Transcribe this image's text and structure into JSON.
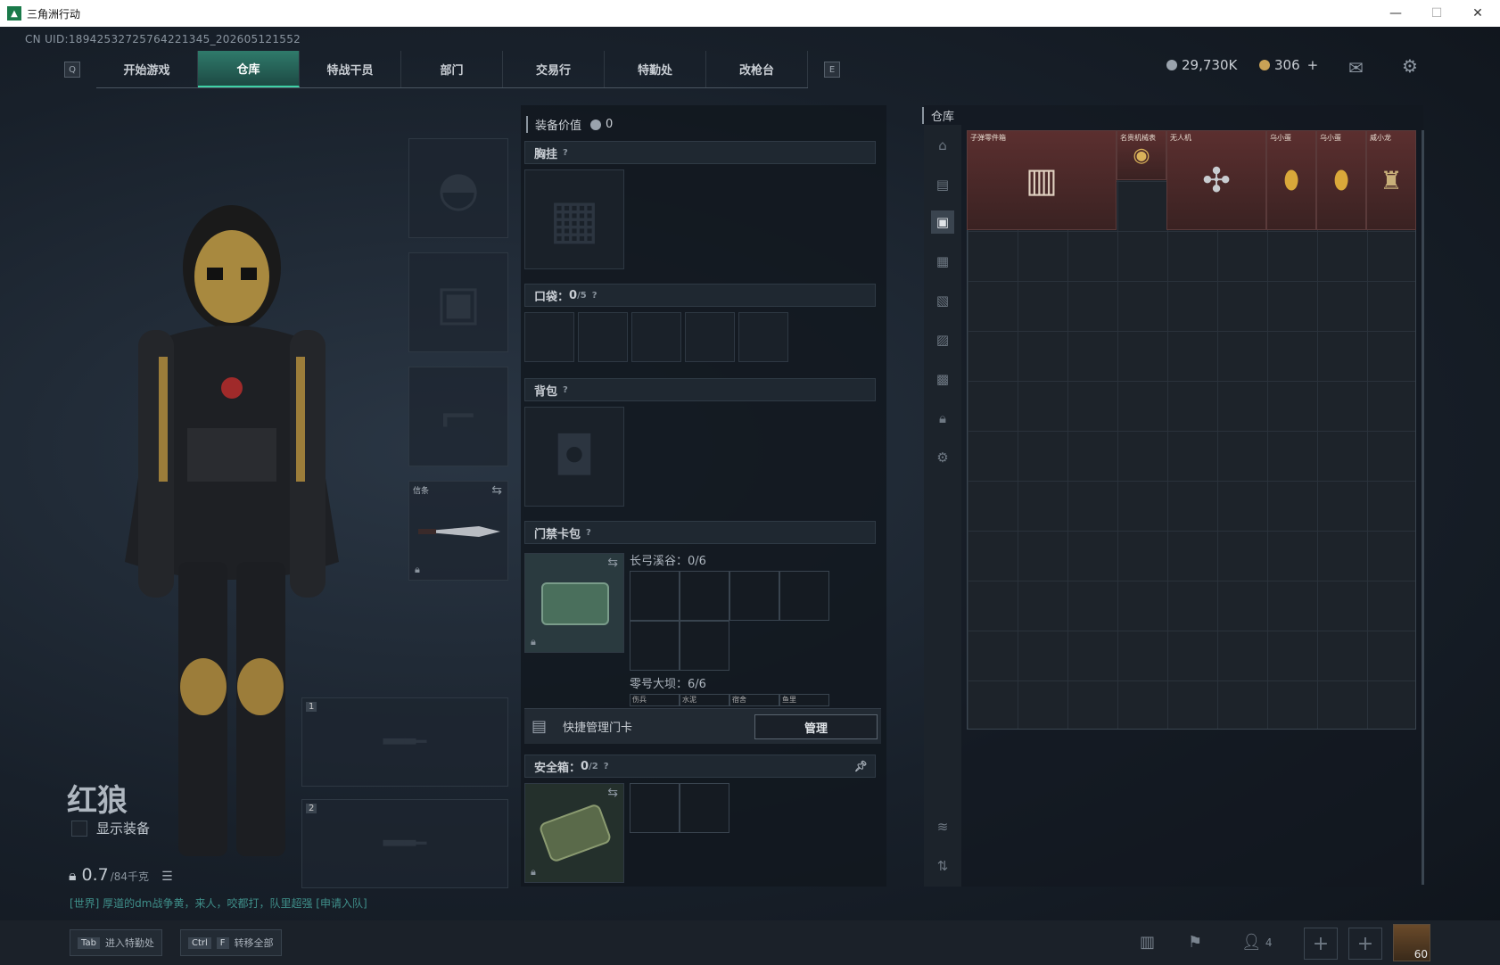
{
  "window": {
    "title": "三角洲行动",
    "min": "—",
    "max": "☐",
    "close": "✕"
  },
  "uid": "CN UID:1894253272576422134​5_202605121552",
  "nav": {
    "left_key": "Q",
    "right_key": "E",
    "tabs": [
      "开始游戏",
      "仓库",
      "特战干员",
      "部门",
      "交易行",
      "特勤处",
      "改枪台"
    ],
    "active": "仓库"
  },
  "currency": {
    "silver": "29,730K",
    "gold": "306",
    "plus": "+"
  },
  "operator": {
    "name": "红狼",
    "show_equipment": "显示装备",
    "weight_value": "0.7",
    "weight_limit": "/84千克",
    "chat": "[世界] 厚道的dm战争黄，来人，咬都打，队里超强 [申请入队]"
  },
  "equip_slots": {
    "melee_label": "信条",
    "weapon1": "1",
    "weapon2": "2"
  },
  "middle": {
    "value_label": "装备价值",
    "value": "0",
    "chest": "胸挂",
    "pockets": "口袋：",
    "pockets_count": "0",
    "pockets_max": "/5",
    "backpack": "背包",
    "keycard_bag": "门禁卡包",
    "keycard_a": "长弓溪谷：0/6",
    "keycard_b": "零号大坝：6/6",
    "keycard_mini": [
      "伤兵",
      "水泥",
      "宿舍",
      "鱼里"
    ],
    "quick_manage": "快捷管理门卡",
    "manage": "管理",
    "safebox": "安全箱：",
    "safebox_count": "0",
    "safebox_max": "/2",
    "question": "?"
  },
  "warehouse": {
    "title": "仓库",
    "items": [
      {
        "name": "子弹零件箱",
        "icon": "crate-icon"
      },
      {
        "name": "名贵机械表",
        "icon": "watch-icon"
      },
      {
        "name": "无人机",
        "icon": "drone-icon"
      },
      {
        "name": "乌小蛋",
        "icon": "egg-figure-icon"
      },
      {
        "name": "乌小蛋",
        "icon": "egg-figure-icon"
      },
      {
        "name": "威小龙",
        "icon": "figure-icon"
      }
    ]
  },
  "bottom": {
    "tab_key": "Tab",
    "tab_label": "进入特勤处",
    "ctrl_key": "Ctrl",
    "f_key": "F",
    "transfer_label": "转移全部",
    "team_count": "4",
    "level": "60"
  },
  "colors": {
    "accent": "#3fd1a6",
    "item_bg": "#5b2f2f"
  }
}
